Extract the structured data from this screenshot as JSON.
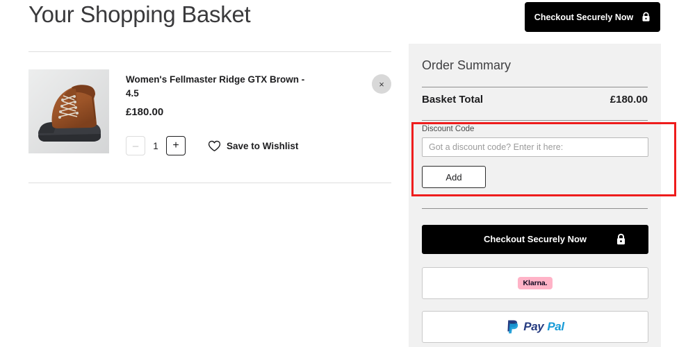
{
  "page": {
    "title": "Your Shopping Basket"
  },
  "top_bar": {
    "checkout_label": "Checkout Securely Now",
    "lock_icon": "lock-icon"
  },
  "basket": {
    "item": {
      "name": "Women's Fellmaster Ridge GTX Brown - 4.5",
      "price": "£180.00",
      "image_alt": "brown-hiking-boot",
      "remove_icon": "×",
      "quantity": "1",
      "decrease_label": "–",
      "increase_label": "+",
      "wishlist_label": "Save to Wishlist",
      "wishlist_icon": "heart-icon"
    }
  },
  "summary": {
    "title": "Order Summary",
    "basket_total_label": "Basket Total",
    "basket_total_value": "£180.00",
    "discount": {
      "label": "Discount Code",
      "placeholder": "Got a discount code? Enter it here:",
      "value": "",
      "add_label": "Add"
    },
    "checkout_label": "Checkout Securely Now",
    "checkout_lock_icon": "lock-icon",
    "payment_options": [
      {
        "name": "Klarna.",
        "icon": "klarna-logo"
      },
      {
        "name": "PayPal",
        "icon": "paypal-logo",
        "part1": "Pay",
        "part2": "Pal"
      }
    ]
  },
  "annotation": {
    "highlight_color": "#ee1c1c",
    "target": "discount-code-section"
  },
  "colors": {
    "panel_bg": "#f1f1f1",
    "button_dark": "#000000",
    "klarna_pink": "#ffb3c7",
    "paypal_dark": "#253b80",
    "paypal_light": "#179bd7"
  }
}
